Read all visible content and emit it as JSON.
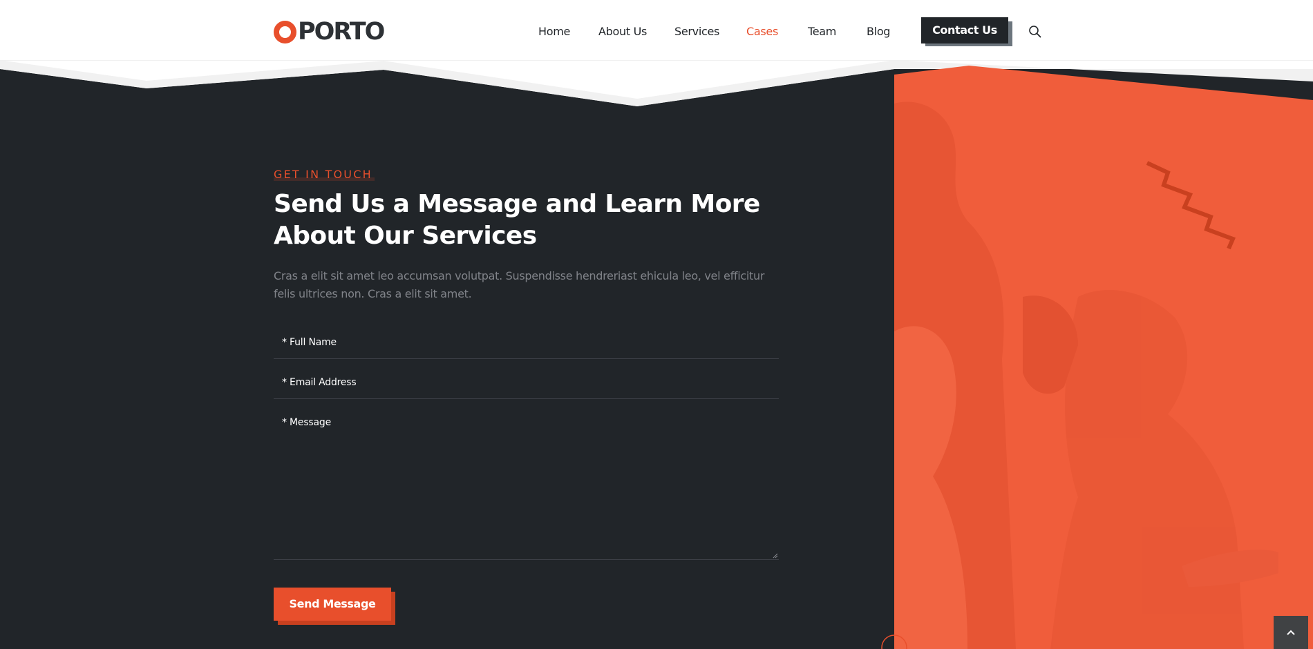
{
  "header": {
    "logo_text": "PORTO",
    "nav": [
      {
        "label": "Home",
        "active": false
      },
      {
        "label": "About Us",
        "active": false
      },
      {
        "label": "Services",
        "active": false
      },
      {
        "label": "Cases",
        "active": true
      },
      {
        "label": "Team",
        "active": false
      },
      {
        "label": "Blog",
        "active": false
      }
    ],
    "contact_label": "Contact Us",
    "search_icon": "search-icon"
  },
  "hero": {
    "eyebrow": "GET IN TOUCH",
    "heading_line1": "Send Us a Message and Learn More",
    "heading_line2": "About Our Services",
    "lead": "Cras a elit sit amet leo accumsan volutpat. Suspendisse hendreriast ehicula leo, vel efficitur felis ultrices non. Cras a elit sit amet."
  },
  "form": {
    "full_name_label": "* Full Name",
    "email_label": "* Email Address",
    "message_label": "* Message",
    "send_label": "Send Message"
  },
  "scroll_top_icon": "chevron-up-icon",
  "colors": {
    "accent": "#e84f2c",
    "dark_bg": "#212529",
    "orange_panel": "#f05d3b",
    "nav_text": "#212529"
  }
}
